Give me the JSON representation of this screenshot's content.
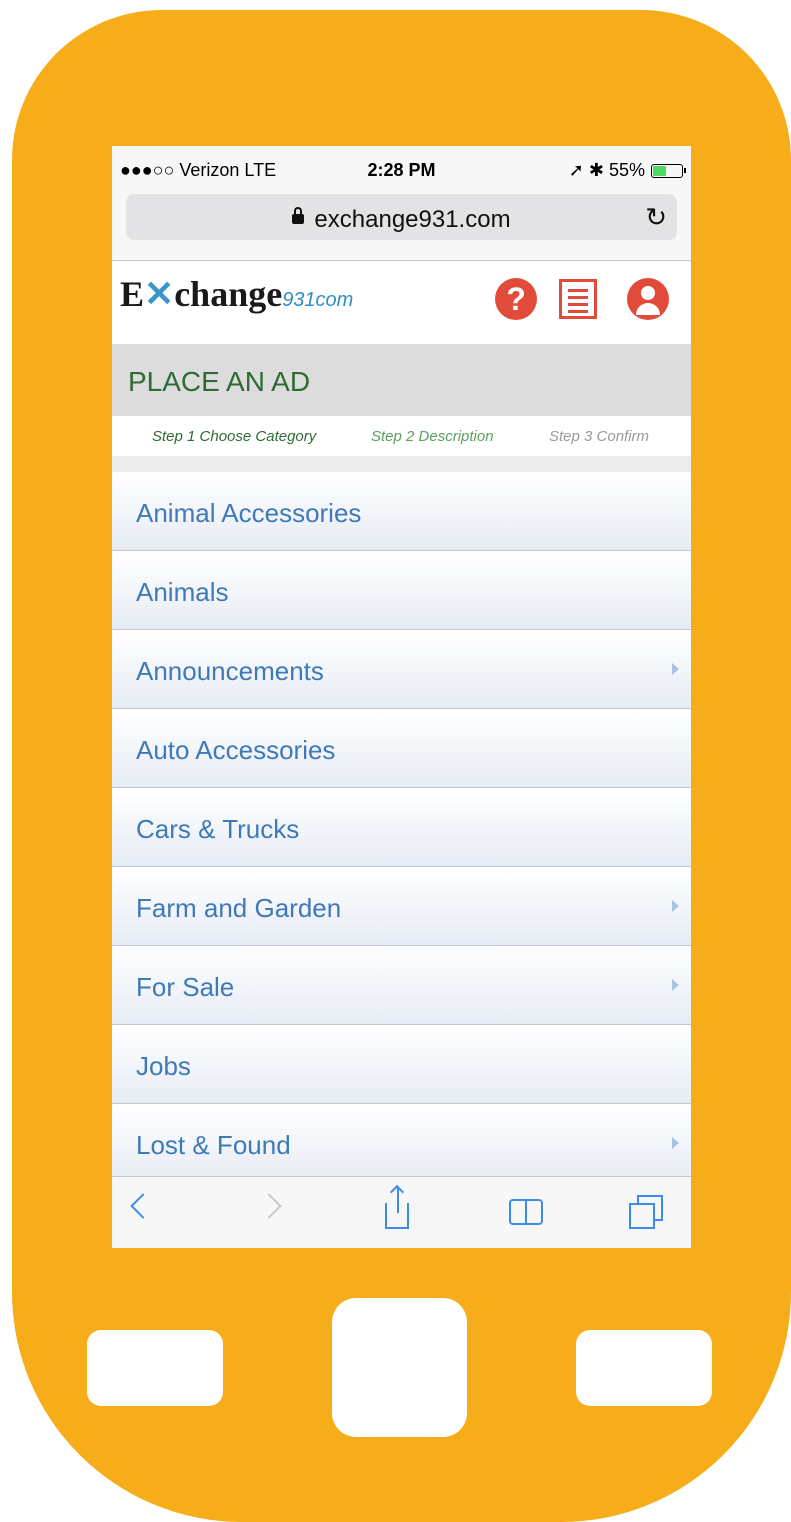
{
  "status_bar": {
    "carrier": "●●●○○ Verizon  LTE",
    "time": "2:28 PM",
    "indicators": "➚ ✱ 55%",
    "battery_percent": 55
  },
  "browser": {
    "url": "exchange931.com",
    "reload_glyph": "↻"
  },
  "site": {
    "logo_main": "E",
    "logo_x": "✕",
    "logo_rest": "change",
    "logo_suffix": "931com",
    "help_glyph": "?"
  },
  "place_ad": {
    "title": "PLACE AN AD"
  },
  "steps": [
    "Step 1 Choose Category",
    "Step 2 Description",
    "Step 3 Confirm"
  ],
  "categories": [
    "Animal Accessories",
    "Animals",
    "Announcements",
    "Auto Accessories",
    "Cars & Trucks",
    "Farm and Garden",
    "For Sale",
    "Jobs",
    "Lost & Found"
  ],
  "colors": {
    "phone_body": "#F7AD1A",
    "accent_red": "#e24b3a",
    "category_text": "#3f79b8",
    "heading_green": "#2f6b35",
    "ios_blue": "#3c8ce7"
  }
}
